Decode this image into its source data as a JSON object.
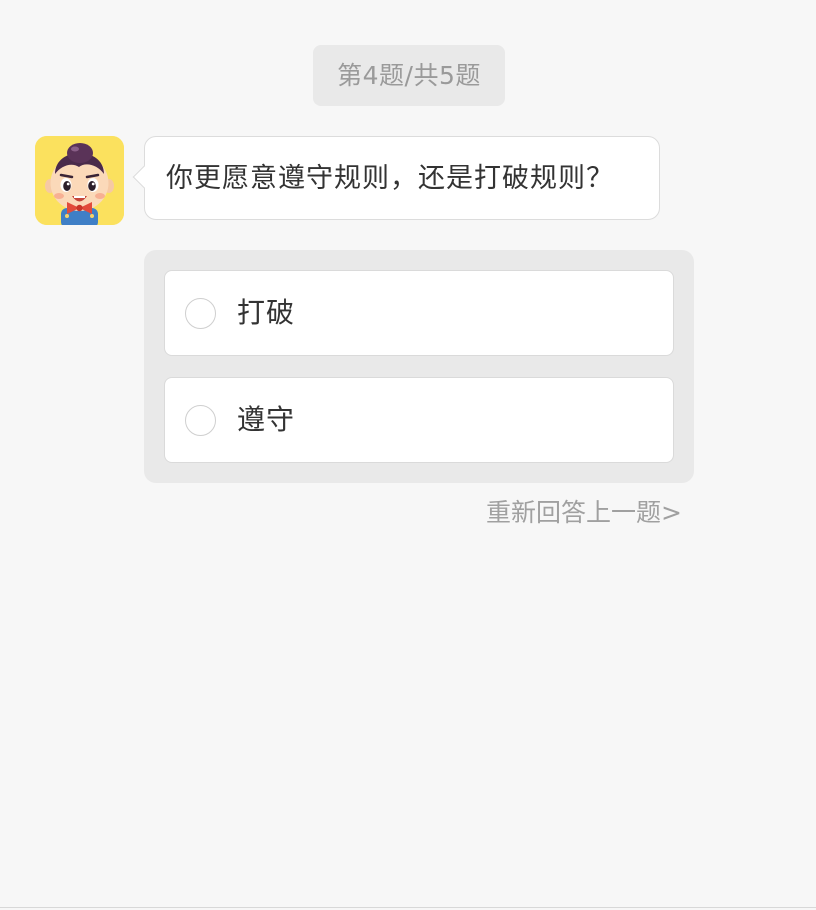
{
  "progress": {
    "label": "第4题/共5题",
    "current": 4,
    "total": 5
  },
  "question": {
    "avatar_icon": "cartoon-boy-avatar-icon",
    "text": "你更愿意遵守规则，还是打破规则？"
  },
  "options": [
    {
      "label": "打破",
      "selected": false
    },
    {
      "label": "遵守",
      "selected": false
    }
  ],
  "actions": {
    "redo_previous": "重新回答上一题>"
  },
  "colors": {
    "background": "#f7f7f7",
    "pill_background": "#e9e9e9",
    "panel_background": "#e9e9e9",
    "card_background": "#ffffff",
    "primary_text": "#333333",
    "secondary_text": "#9a9a9a",
    "avatar_background": "#fbe15e"
  }
}
